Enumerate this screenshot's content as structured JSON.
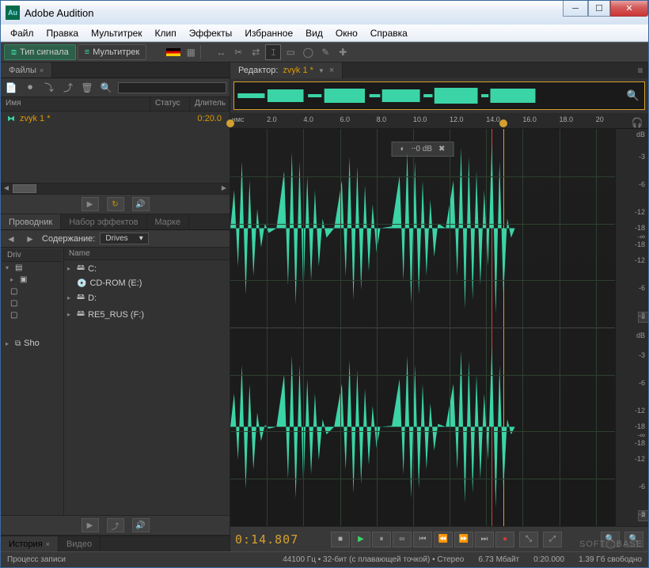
{
  "titlebar": {
    "app_name": "Adobe Audition"
  },
  "menubar": [
    "Файл",
    "Правка",
    "Мультитрек",
    "Клип",
    "Эффекты",
    "Избранное",
    "Вид",
    "Окно",
    "Справка"
  ],
  "toolbar": {
    "signal_btn": "Тип сигнала",
    "multitrack_btn": "Мультитрек"
  },
  "files_panel": {
    "tab": "Файлы",
    "cols": {
      "name": "Имя",
      "status": "Статус",
      "duration": "Длитель"
    },
    "rows": [
      {
        "name": "zvyk 1 *",
        "duration": "0:20.0"
      }
    ]
  },
  "browser": {
    "tabs": [
      "Проводник",
      "Набор эффектов",
      "Марке"
    ],
    "label_contents": "Содержание:",
    "dropdown": "Drives",
    "left_col": "Driv",
    "left_items": [
      "Sho"
    ],
    "right_col": "Name",
    "drives": [
      "C:",
      "CD-ROM (E:)",
      "D:",
      "RE5_RUS (F:)"
    ]
  },
  "history_tabs": [
    "История",
    "Видео"
  ],
  "editor": {
    "tab_prefix": "Редактор:",
    "tab_file": "zvyk 1 *",
    "ruler_unit": "чмс",
    "ruler_ticks": [
      "2.0",
      "4.0",
      "6.0",
      "8.0",
      "10.0",
      "12.0",
      "14.0",
      "16.0",
      "18.0",
      "20"
    ],
    "db_label": "dB",
    "db_ticks": [
      "-3",
      "-6",
      "-12",
      "-18",
      "-∞",
      "-18",
      "-12",
      "-6",
      "-3"
    ],
    "gain_popup": "+0 dB",
    "channel_L": "L",
    "channel_R": "R",
    "timecode": "0:14.807"
  },
  "statusbar": {
    "process": "Процесс записи",
    "sample": "44100 Гц • 32-бит (с плавающей точкой) • Стерео",
    "filesize": "6.73 Мбайт",
    "duration": "0:20.000",
    "diskfree": "1.39 Гб свободно"
  },
  "watermark": "SOFT◯BASE"
}
